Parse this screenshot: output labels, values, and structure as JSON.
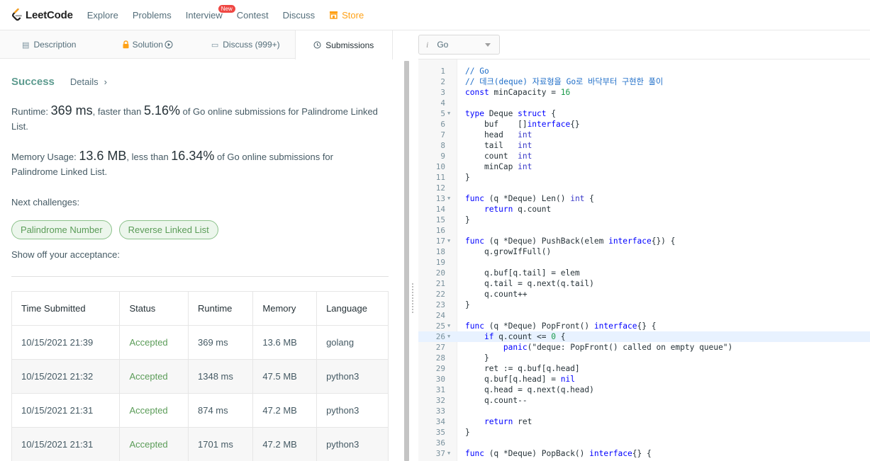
{
  "nav": {
    "brand": "LeetCode",
    "items": [
      "Explore",
      "Problems",
      "Interview",
      "Contest",
      "Discuss",
      "Store"
    ],
    "new_badge": "New",
    "store_color": "#ffa116"
  },
  "tabs": [
    {
      "label": "Description",
      "icon": "document-icon"
    },
    {
      "label": "Solution",
      "icon": "lock-icon"
    },
    {
      "label": "Discuss (999+)",
      "icon": "comment-icon"
    },
    {
      "label": "Submissions",
      "icon": "clock-icon"
    }
  ],
  "result": {
    "status": "Success",
    "details": "Details",
    "runtime_label": "Runtime: ",
    "runtime_value": "369 ms",
    "runtime_mid": ", faster than ",
    "runtime_pct": "5.16%",
    "runtime_tail": " of Go online submissions for Palindrome Linked List.",
    "memory_label": "Memory Usage: ",
    "memory_value": "13.6 MB",
    "memory_mid": ", less than ",
    "memory_pct": "16.34%",
    "memory_tail": " of Go online submissions for Palindrome Linked List.",
    "next_label": "Next challenges:",
    "challenges": [
      "Palindrome Number",
      "Reverse Linked List"
    ],
    "show_off": "Show off your acceptance:"
  },
  "table": {
    "headers": [
      "Time Submitted",
      "Status",
      "Runtime",
      "Memory",
      "Language"
    ],
    "rows": [
      [
        "10/15/2021 21:39",
        "Accepted",
        "369 ms",
        "13.6 MB",
        "golang"
      ],
      [
        "10/15/2021 21:32",
        "Accepted",
        "1348 ms",
        "47.5 MB",
        "python3"
      ],
      [
        "10/15/2021 21:31",
        "Accepted",
        "874 ms",
        "47.2 MB",
        "python3"
      ],
      [
        "10/15/2021 21:31",
        "Accepted",
        "1701 ms",
        "47.2 MB",
        "python3"
      ]
    ]
  },
  "editor": {
    "language": "Go",
    "info_glyph": "i",
    "highlight_line": 26,
    "fold_lines": [
      5,
      13,
      17,
      25,
      26,
      37
    ],
    "lines": [
      "// Go",
      "// 데크(deque) 자료형을 Go로 바닥부터 구현한 풀이",
      "const minCapacity = 16",
      "",
      "type Deque struct {",
      "    buf    []interface{}",
      "    head   int",
      "    tail   int",
      "    count  int",
      "    minCap int",
      "}",
      "",
      "func (q *Deque) Len() int {",
      "    return q.count",
      "}",
      "",
      "func (q *Deque) PushBack(elem interface{}) {",
      "    q.growIfFull()",
      "",
      "    q.buf[q.tail] = elem",
      "    q.tail = q.next(q.tail)",
      "    q.count++",
      "}",
      "",
      "func (q *Deque) PopFront() interface{} {",
      "    if q.count <= 0 {",
      "        panic(\"deque: PopFront() called on empty queue\")",
      "    }",
      "    ret := q.buf[q.head]",
      "    q.buf[q.head] = nil",
      "    q.head = q.next(q.head)",
      "    q.count--",
      "",
      "    return ret",
      "}",
      "",
      "func (q *Deque) PopBack() interface{} {"
    ]
  }
}
